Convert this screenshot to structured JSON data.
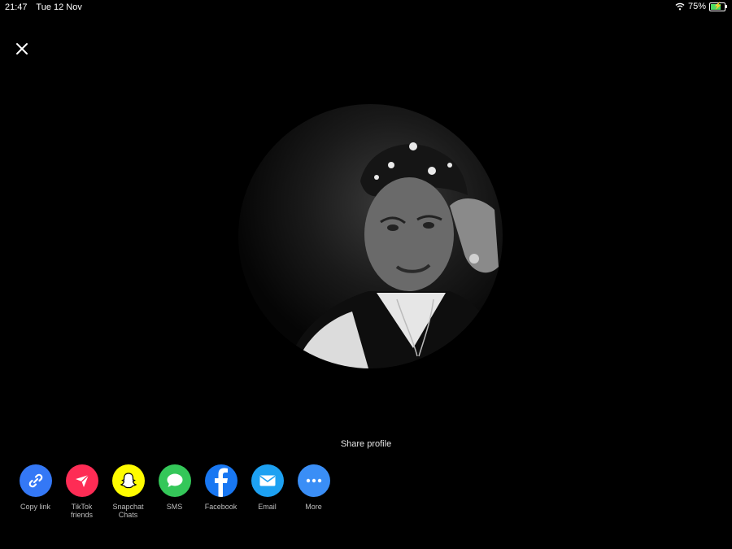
{
  "status_bar": {
    "time": "21:47",
    "date": "Tue 12 Nov",
    "battery": "75%",
    "battery_fill": 0.75
  },
  "share": {
    "title": "Share profile",
    "items": [
      {
        "label": "Copy link",
        "icon": "link-icon",
        "color": "#3478f6"
      },
      {
        "label": "TikTok\nfriends",
        "icon": "send-icon",
        "color": "#fe2c55"
      },
      {
        "label": "Snapchat\nChats",
        "icon": "snapchat-ghost-icon",
        "color": "#fffc00"
      },
      {
        "label": "SMS",
        "icon": "message-bubble-icon",
        "color": "#34c759"
      },
      {
        "label": "Facebook",
        "icon": "facebook-icon",
        "color": "#1877f2"
      },
      {
        "label": "Email",
        "icon": "envelope-icon",
        "color": "#1da1f2"
      },
      {
        "label": "More",
        "icon": "more-dots-icon",
        "color": "#3a8ef6"
      }
    ]
  }
}
